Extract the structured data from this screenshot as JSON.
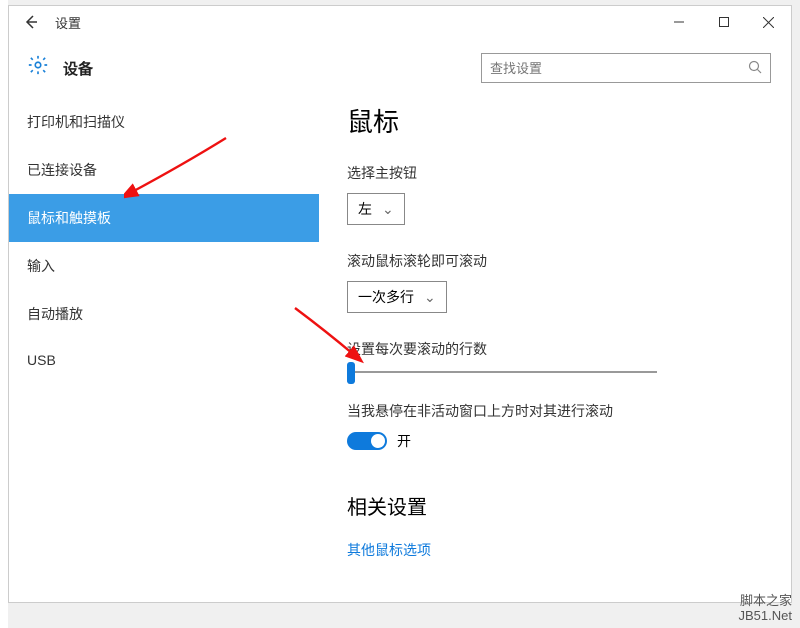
{
  "titlebar": {
    "title": "设置"
  },
  "header": {
    "title": "设备",
    "search_placeholder": "查找设置"
  },
  "sidebar": {
    "items": [
      {
        "label": "打印机和扫描仪"
      },
      {
        "label": "已连接设备"
      },
      {
        "label": "鼠标和触摸板"
      },
      {
        "label": "输入"
      },
      {
        "label": "自动播放"
      },
      {
        "label": "USB"
      }
    ]
  },
  "content": {
    "page_title": "鼠标",
    "primary_button_label": "选择主按钮",
    "primary_button_value": "左",
    "scroll_mode_label": "滚动鼠标滚轮即可滚动",
    "scroll_mode_value": "一次多行",
    "lines_label": "设置每次要滚动的行数",
    "inactive_hover_label": "当我悬停在非活动窗口上方时对其进行滚动",
    "toggle_state": "开",
    "related_heading": "相关设置",
    "related_link": "其他鼠标选项"
  },
  "watermark": {
    "line1": "脚本之家",
    "line2": "JB51.Net"
  }
}
